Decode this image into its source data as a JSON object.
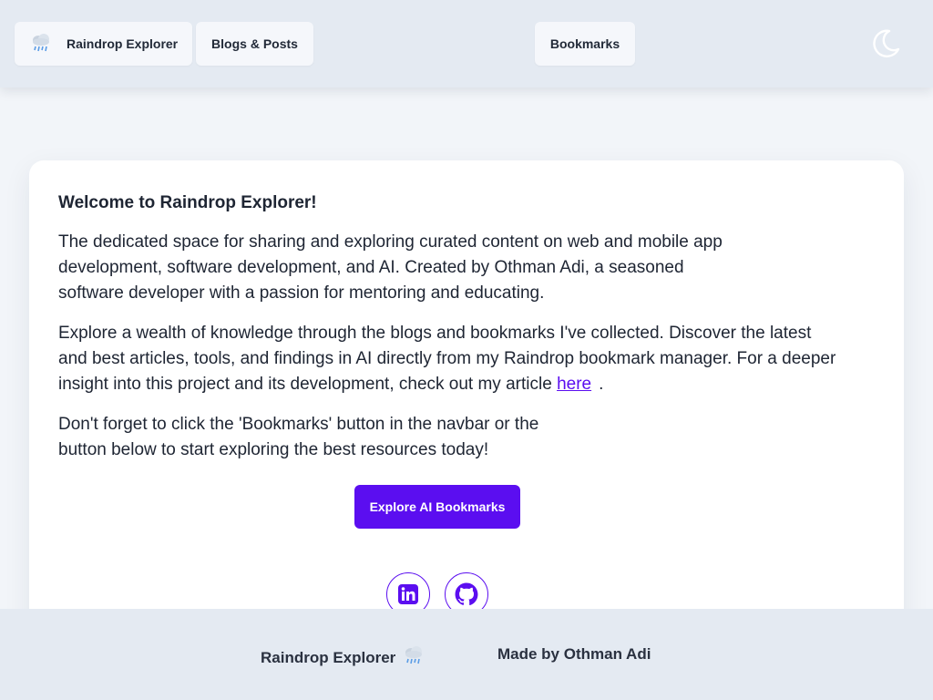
{
  "navbar": {
    "brand_label": "Raindrop Explorer",
    "brand_icon": "rain-cloud-icon",
    "blogs_label": "Blogs & Posts",
    "bookmarks_label": "Bookmarks",
    "theme_icon": "moon-icon"
  },
  "main": {
    "title": "Welcome to Raindrop Explorer!",
    "para1": "The dedicated space for sharing and exploring curated content on web and mobile app development, software development, and AI. Created by Othman Adi, a seasoned software developer with a passion for mentoring and educating.",
    "para2_text": "Explore a wealth of knowledge through the blogs and bookmarks I've collected. Discover the latest and best articles, tools, and findings in AI directly from my Raindrop bookmark manager. For a deeper insight into this project and its development, check out my article ",
    "para2_link": "here",
    "para2_end": ".",
    "para3": "Don't forget to click the 'Bookmarks' button in the navbar or the button below to start exploring the best resources today!",
    "cta_label": "Explore AI Bookmarks",
    "socials": [
      "linkedin-icon",
      "github-icon"
    ]
  },
  "footer": {
    "brand_label": "Raindrop Explorer",
    "credit_label": "Made by Othman Adi"
  },
  "colors": {
    "accent": "#5b0ef0",
    "nav_bg": "#e4eaf2",
    "page_bg": "#f2f5f9"
  }
}
